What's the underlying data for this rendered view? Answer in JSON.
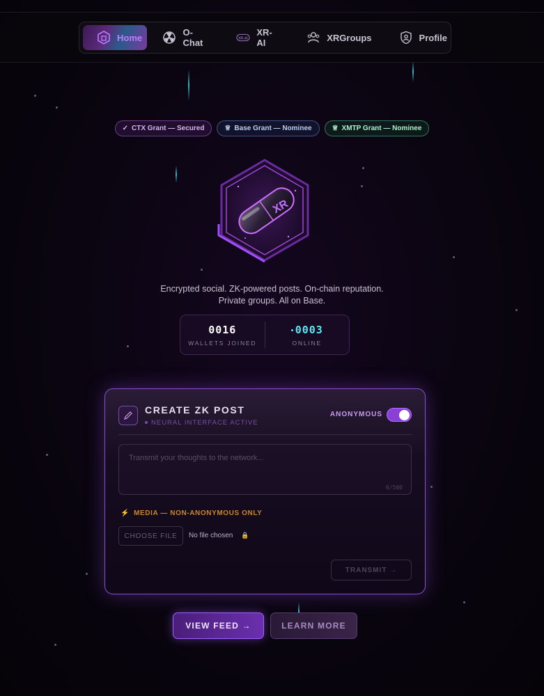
{
  "nav": {
    "items": [
      {
        "label": "Home",
        "icon": "home-hex-icon",
        "active": true
      },
      {
        "label": "O-Chat",
        "icon": "radiation-icon"
      },
      {
        "label": "XR-AI",
        "icon": "xr-ai-chip-icon"
      },
      {
        "label": "XRGroups",
        "icon": "users-icon"
      },
      {
        "label": "Profile",
        "icon": "shield-user-icon"
      }
    ]
  },
  "badges": [
    {
      "label": "CTX Grant — Secured",
      "icon": "check-icon",
      "glyph": "✓"
    },
    {
      "label": "Base Grant — Nominee",
      "icon": "award-icon",
      "glyph": "♕"
    },
    {
      "label": "XMTP Grant — Nominee",
      "icon": "award-icon",
      "glyph": "♕"
    }
  ],
  "logo": {
    "text": "XR"
  },
  "tagline": {
    "line1": "Encrypted social. ZK-powered posts. On-chain reputation.",
    "line2": "Private groups. All on Base."
  },
  "stats": {
    "wallets": {
      "value": "0016",
      "label": "WALLETS JOINED"
    },
    "online": {
      "value": "0003",
      "label": "ONLINE"
    }
  },
  "post_card": {
    "title": "CREATE ZK POST",
    "subtitle": "NEURAL INTERFACE ACTIVE",
    "anonymous_label": "ANONYMOUS",
    "anonymous_on": true,
    "placeholder": "Transmit your thoughts to the network...",
    "char_count": "0/500",
    "media_note": "MEDIA — NON-ANONYMOUS ONLY",
    "choose_file": "CHOOSE FILE",
    "no_file": "No file chosen",
    "transmit": "TRANSMIT →"
  },
  "actions": {
    "view_feed": "VIEW FEED →",
    "learn_more": "LEARN MORE"
  },
  "colors": {
    "accent": "#a060ff",
    "cyan": "#5fe8f5",
    "warning": "#c9862a"
  }
}
